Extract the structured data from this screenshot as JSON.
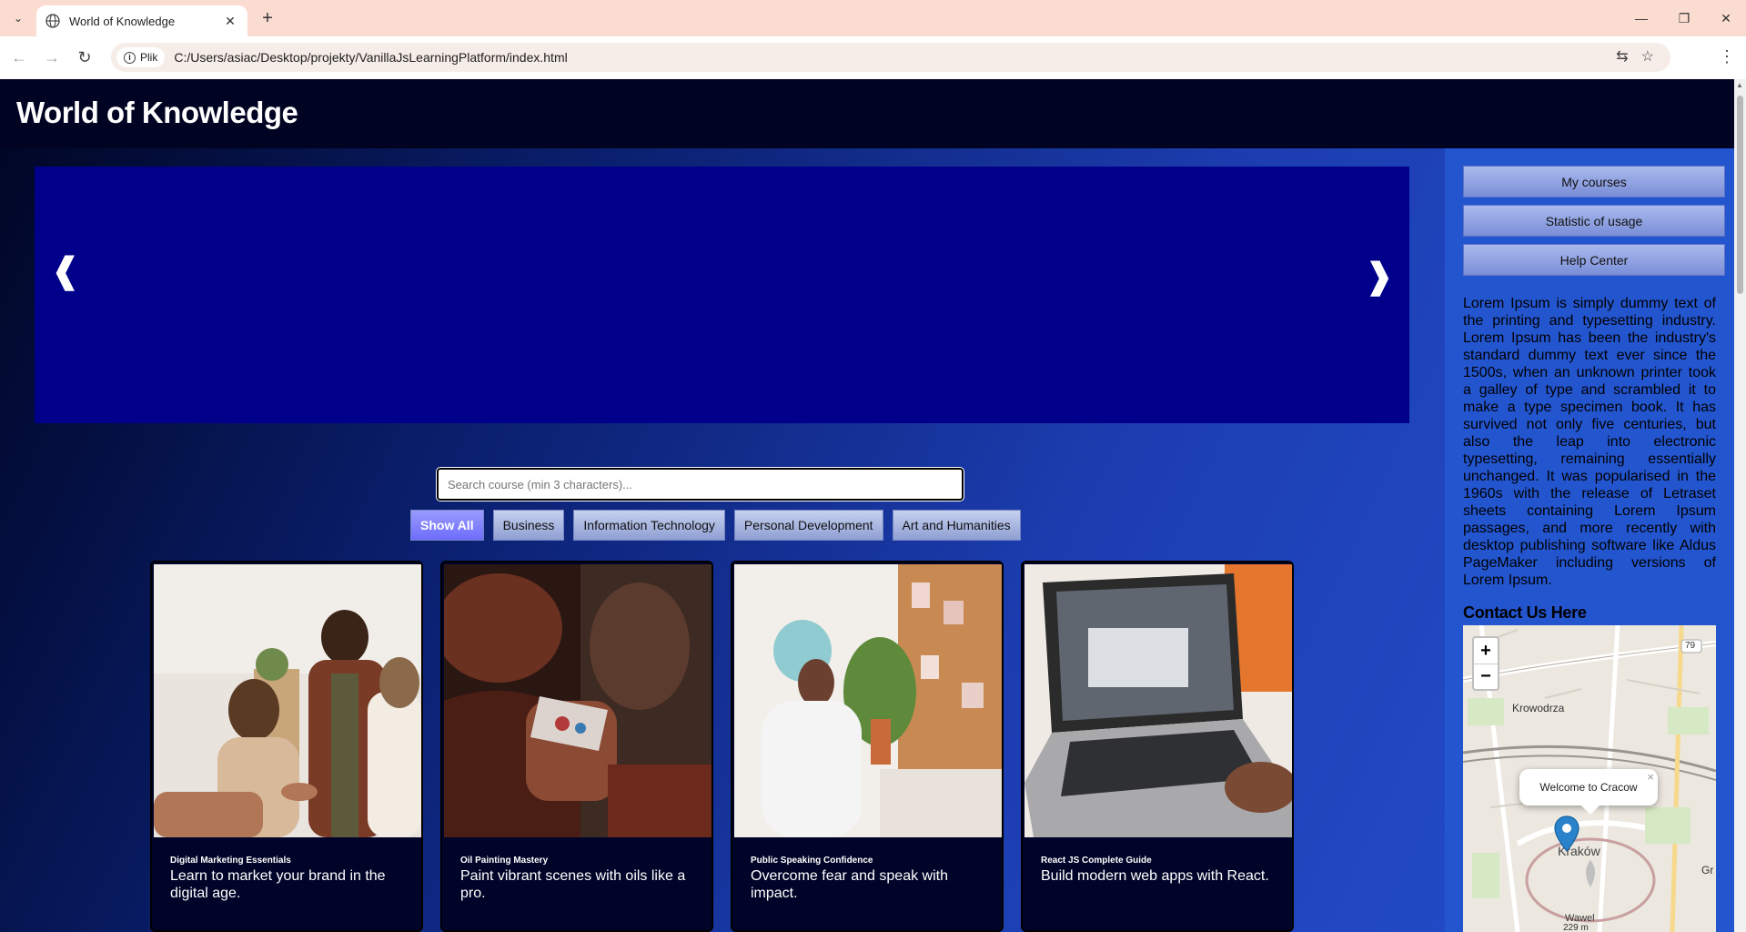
{
  "browser": {
    "tab_title": "World of Knowledge",
    "site_chip": "Plik",
    "url": "C:/Users/asiac/Desktop/projekty/VanillaJsLearningPlatform/index.html",
    "icons": [
      "tab-list-icon",
      "globe-icon",
      "close-icon",
      "plus-icon",
      "minimize-icon",
      "restore-icon",
      "close-window-icon",
      "back-icon",
      "forward-icon",
      "reload-icon",
      "info-icon",
      "translate-icon",
      "star-icon",
      "menu-icon"
    ]
  },
  "header": {
    "title": "World of Knowledge"
  },
  "slider": {
    "prev": "❰",
    "next": "❱"
  },
  "search": {
    "placeholder": "Search course (min 3 characters)...",
    "value": ""
  },
  "filters": [
    {
      "label": "Show All",
      "active": true
    },
    {
      "label": "Business",
      "active": false
    },
    {
      "label": "Information Technology",
      "active": false
    },
    {
      "label": "Personal Development",
      "active": false
    },
    {
      "label": "Art and Humanities",
      "active": false
    }
  ],
  "courses": [
    {
      "title": "Digital Marketing Essentials",
      "description": "Learn to market your brand in the digital age."
    },
    {
      "title": "Oil Painting Mastery",
      "description": "Paint vibrant scenes with oils like a pro."
    },
    {
      "title": "Public Speaking Confidence",
      "description": "Overcome fear and speak with impact."
    },
    {
      "title": "React JS Complete Guide",
      "description": "Build modern web apps with React."
    }
  ],
  "sidebar": {
    "buttons": [
      "My courses",
      "Statistic of usage",
      "Help Center"
    ],
    "text": "Lorem Ipsum is simply dummy text of the printing and typesetting industry. Lorem Ipsum has been the industry's standard dummy text ever since the 1500s, when an unknown printer took a galley of type and scrambled it to make a type specimen book. It has survived not only five centuries, but also the leap into electronic typesetting, remaining essentially unchanged. It was popularised in the 1960s with the release of Letraset sheets containing Lorem Ipsum passages, and more recently with desktop publishing software like Aldus PageMaker including versions of Lorem Ipsum.",
    "contact_title": "Contact Us Here"
  },
  "map": {
    "zoom_in": "+",
    "zoom_out": "−",
    "popup_text": "Welcome to Cracow",
    "popup_close": "×",
    "labels": {
      "district": "Krowodrza",
      "city": "Kraków",
      "castle": "Wawel",
      "elevation": "229 m",
      "road": "79",
      "edge": "Gr"
    }
  },
  "colors": {
    "header_bg": "#000321",
    "slider_bg": "#00008b",
    "card_bg": "#000428",
    "sidebar_bg": "#2355cf",
    "active_filter": "#7a7aff"
  }
}
